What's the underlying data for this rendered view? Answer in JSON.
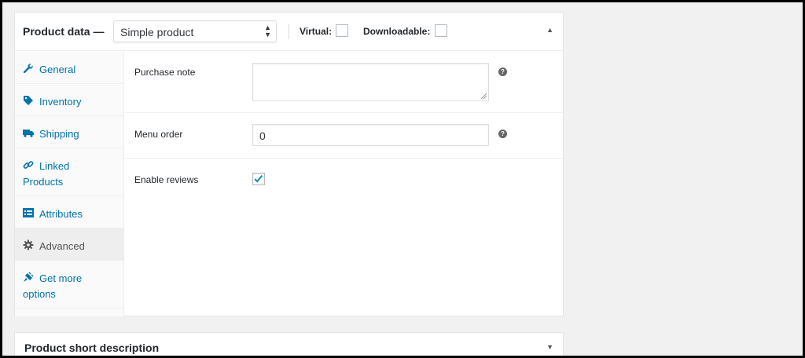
{
  "product_data": {
    "title": "Product data —",
    "type_select": "Simple product",
    "virtual_label": "Virtual:",
    "virtual_checked": false,
    "downloadable_label": "Downloadable:",
    "downloadable_checked": false,
    "collapse_icon": "triangle-up-icon"
  },
  "tabs": [
    {
      "id": "general",
      "label": "General",
      "icon": "wrench-icon",
      "active": false
    },
    {
      "id": "inventory",
      "label": "Inventory",
      "icon": "tag-icon",
      "active": false
    },
    {
      "id": "shipping",
      "label": "Shipping",
      "icon": "truck-icon",
      "active": false
    },
    {
      "id": "linked-products",
      "label": "Linked",
      "label2": "Products",
      "icon": "link-icon",
      "active": false
    },
    {
      "id": "attributes",
      "label": "Attributes",
      "icon": "list-icon",
      "active": false
    },
    {
      "id": "advanced",
      "label": "Advanced",
      "icon": "gear-icon",
      "active": true
    },
    {
      "id": "get-more-options",
      "label": "Get more",
      "label2": "options",
      "icon": "plugin-icon",
      "active": false
    }
  ],
  "fields": {
    "purchase_note": {
      "label": "Purchase note",
      "value": ""
    },
    "menu_order": {
      "label": "Menu order",
      "value": "0"
    },
    "enable_reviews": {
      "label": "Enable reviews",
      "checked": true
    }
  },
  "short_description": {
    "title": "Product short description"
  },
  "colors": {
    "link": "#0073aa",
    "check": "#1e8cbe",
    "background": "#f1f1f1"
  }
}
